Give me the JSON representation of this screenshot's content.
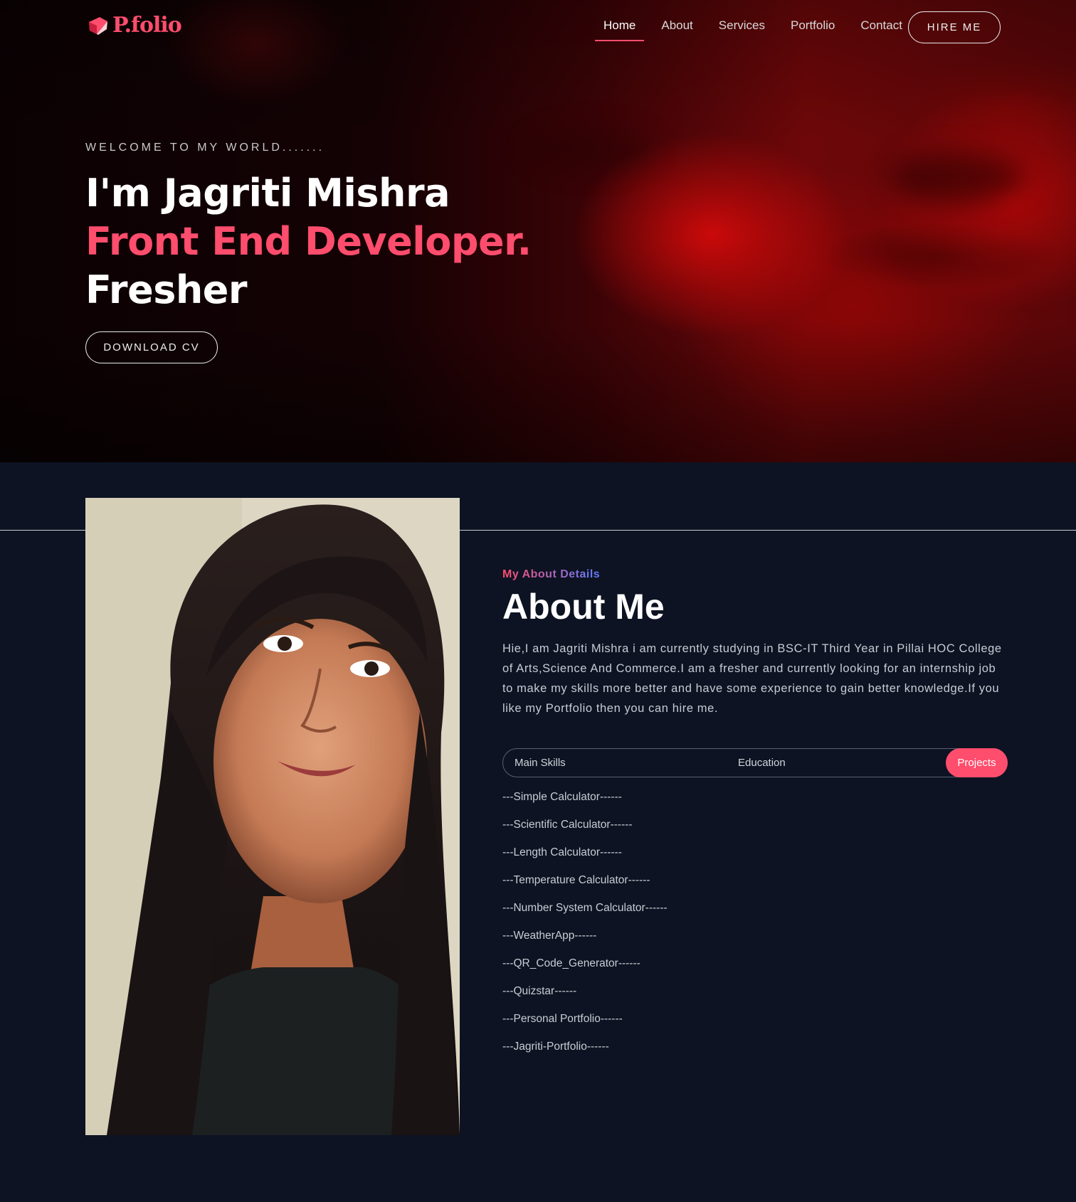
{
  "header": {
    "logo_text": "P.folio",
    "nav": [
      "Home",
      "About",
      "Services",
      "Portfolio",
      "Contact"
    ],
    "active_nav": "Home",
    "hire_label": "HIRE ME"
  },
  "hero": {
    "welcome": "WELCOME TO MY WORLD.......",
    "line1": "I'm Jagriti Mishra",
    "line2": "Front End Developer.",
    "line3": "Fresher",
    "cv_label": "DOWNLOAD CV"
  },
  "about": {
    "subtitle": "My About Details",
    "title": "About Me",
    "text": "Hie,I am Jagriti Mishra i am currently studying in BSC-IT Third Year in Pillai HOC College of Arts,Science And Commerce.I am a fresher and currently looking for an internship job to make my skills more better and have some experience to gain better knowledge.If you like my Portfolio then you can hire me.",
    "tabs": [
      "Main Skills",
      "Education",
      "Projects"
    ],
    "active_tab": "Projects",
    "projects": [
      "---Simple Calculator------",
      "---Scientific Calculator------",
      "---Length Calculator------",
      "---Temperature Calculator------",
      "---Number System Calculator------",
      "---WeatherApp------",
      "---QR_Code_Generator------",
      "---Quizstar------",
      "---Personal Portfolio------",
      "---Jagriti-Portfolio------"
    ]
  },
  "colors": {
    "accent": "#ff4d6d",
    "background": "#0d1322",
    "hero_red": "#8a0a0a"
  }
}
